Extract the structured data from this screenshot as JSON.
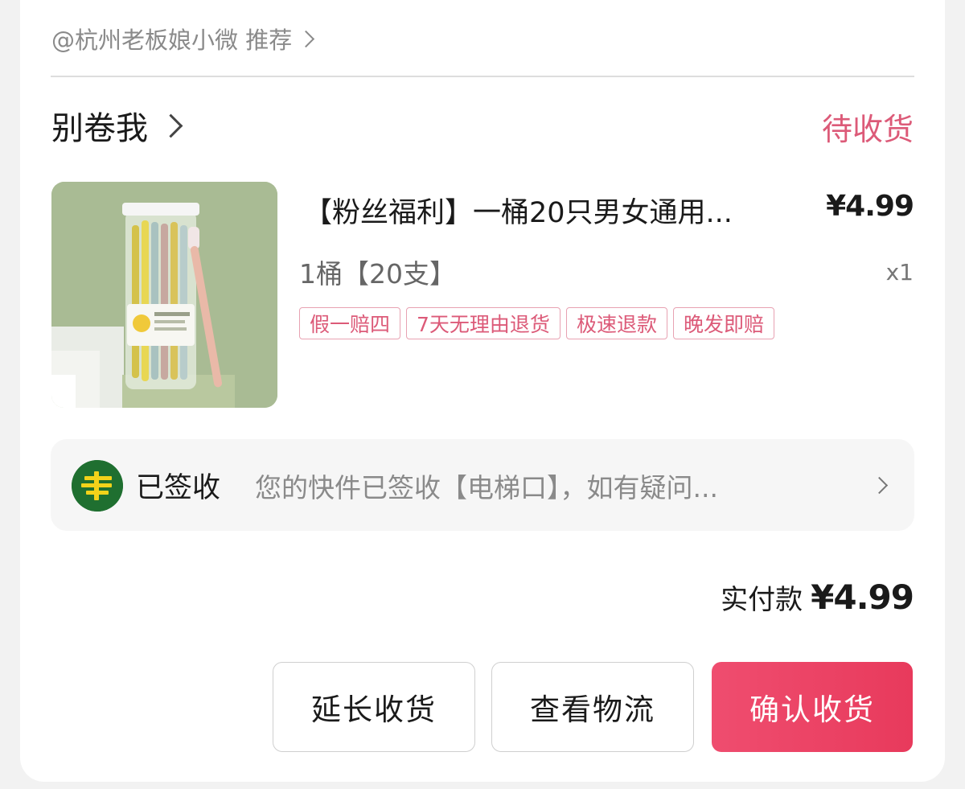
{
  "recommend": {
    "text": "@杭州老板娘小微 推荐"
  },
  "shop": {
    "name": "别卷我",
    "status": "待收货"
  },
  "product": {
    "title": "【粉丝福利】一桶20只男女通用...",
    "price": "¥4.99",
    "spec": "1桶【20支】",
    "quantity": "x1",
    "tags": [
      "假一赔四",
      "7天无理由退货",
      "极速退款",
      "晚发即赔"
    ],
    "image_label": "toothbrush-tube-product-photo"
  },
  "logistics": {
    "status": "已签收",
    "detail": "您的快件已签收【电梯口】，如有疑问...",
    "carrier_icon": "china-post-logo-icon"
  },
  "payment": {
    "label": "实付款",
    "amount": "¥4.99"
  },
  "actions": {
    "extend": "延长收货",
    "track": "查看物流",
    "confirm": "确认收货"
  },
  "colors": {
    "accent": "#e83a5c",
    "status_pink": "#dc5a78",
    "tag_border": "#e8a2b2",
    "logistics_bg": "#f6f6f6",
    "post_green": "#1f6f30",
    "post_yellow": "#f2d21a"
  }
}
